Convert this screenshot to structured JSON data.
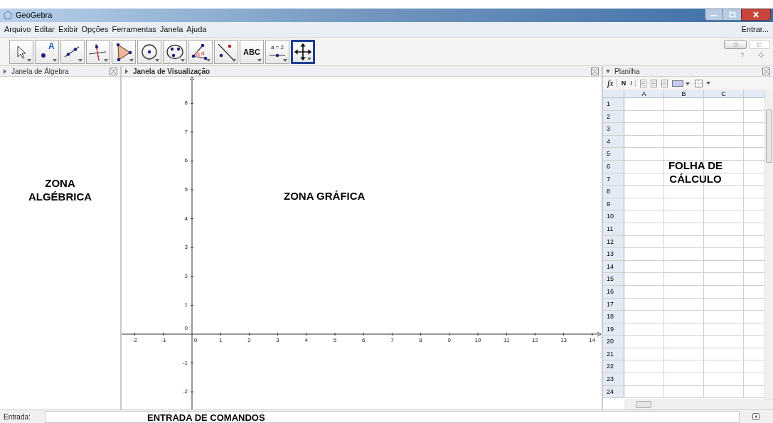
{
  "window": {
    "title": "GeoGebra"
  },
  "menu": [
    "Arquivo",
    "Editar",
    "Exibir",
    "Opções",
    "Ferramentas",
    "Janela",
    "Ajuda"
  ],
  "login": "Entrar...",
  "tools": [
    {
      "kind": "pointer",
      "selected": false
    },
    {
      "kind": "point",
      "label": "A",
      "selected": false
    },
    {
      "kind": "line",
      "selected": false
    },
    {
      "kind": "perpendicular",
      "selected": false
    },
    {
      "kind": "polygon",
      "selected": false
    },
    {
      "kind": "circle",
      "selected": false
    },
    {
      "kind": "conic",
      "selected": false
    },
    {
      "kind": "angle",
      "label": "α",
      "selected": false
    },
    {
      "kind": "reflect",
      "selected": false
    },
    {
      "kind": "text",
      "label": "ABC",
      "selected": false
    },
    {
      "kind": "slider",
      "label": "a = 2",
      "selected": false
    },
    {
      "kind": "move",
      "selected": true
    }
  ],
  "help": "?",
  "algebra": {
    "title": "Janela de Álgebra",
    "note": "ZONA ALGÉBRICA"
  },
  "graphics": {
    "title": "Janela de Visualização",
    "note": "ZONA GRÁFICA",
    "x_ticks": [
      "-2",
      "-1",
      "0",
      "1",
      "2",
      "3",
      "4",
      "5",
      "6",
      "7",
      "8",
      "9",
      "10",
      "11",
      "12",
      "13",
      "14"
    ],
    "y_ticks": [
      "8",
      "7",
      "6",
      "5",
      "4",
      "3",
      "2",
      "1",
      "0",
      "-1",
      "-2"
    ]
  },
  "spreadsheet": {
    "title": "Planilha",
    "note": "FOLHA DE CÁLCULO",
    "toolbar": {
      "fx": "fx",
      "bold": "N",
      "italic": "I"
    },
    "columns": [
      "A",
      "B",
      "C"
    ],
    "rows": [
      "1",
      "2",
      "3",
      "4",
      "5",
      "6",
      "7",
      "8",
      "9",
      "10",
      "11",
      "12",
      "13",
      "14",
      "15",
      "16",
      "17",
      "18",
      "19",
      "20",
      "21",
      "22",
      "23",
      "24"
    ]
  },
  "input_bar": {
    "label": "Entrada:",
    "note": "ENTRADA DE COMANDOS"
  }
}
